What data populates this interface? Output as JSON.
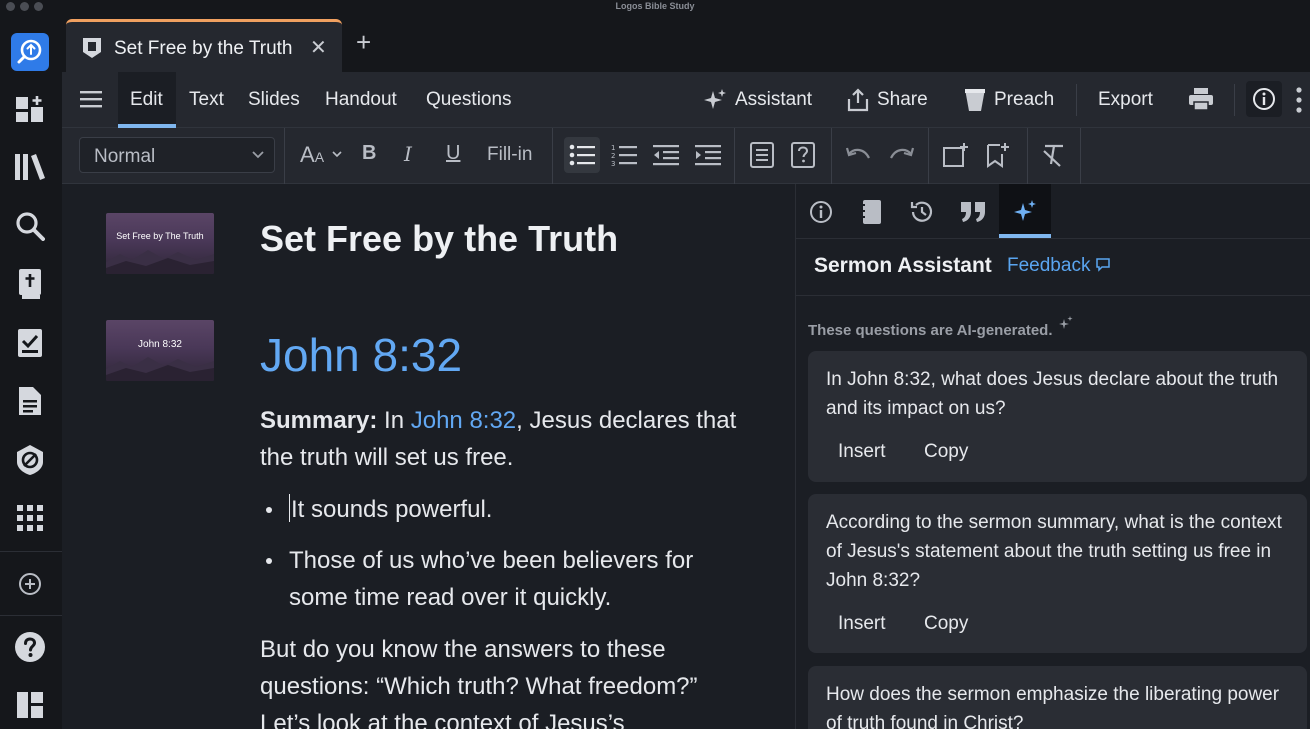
{
  "window": {
    "title": "Logos Bible Study"
  },
  "tab": {
    "title": "Set Free by the Truth",
    "close": "✕",
    "add": "+"
  },
  "menu": {
    "items": [
      "Edit",
      "Text",
      "Slides",
      "Handout",
      "Questions"
    ],
    "active": "Edit",
    "assistant": "Assistant",
    "share": "Share",
    "preach": "Preach",
    "export": "Export"
  },
  "format": {
    "style": "Normal",
    "font_size_icon": "A",
    "font_size_icon_small": "A",
    "bold": "B",
    "italic": "I",
    "underline": "U",
    "fill_in": "Fill-in"
  },
  "editor": {
    "title": "Set Free by the Truth",
    "slide1_text": "Set Free by The Truth",
    "slide2_text": "John 8:32",
    "reference": "John 8:32",
    "summary_label": "Summary:",
    "summary_pre": " In ",
    "summary_link": "John 8:32",
    "summary_post": ", Jesus declares that the truth will set us free.",
    "bullet1": "It sounds powerful.",
    "bullet2": "Those of us who’ve been believers for some time read over it quickly.",
    "para2": "But do you know the answers to these questions: “Which truth? What freedom?” Let’s look at the context of Jesus’s"
  },
  "panel": {
    "title": "Sermon Assistant",
    "feedback": "Feedback",
    "ai_note": "These questions are AI-generated.",
    "cards": [
      {
        "question": "In John 8:32, what does Jesus declare about the truth and its impact on us?",
        "insert": "Insert",
        "copy": "Copy"
      },
      {
        "question": "According to the sermon summary, what is the context of Jesus's statement about the truth setting us free in John 8:32?",
        "insert": "Insert",
        "copy": "Copy"
      },
      {
        "question": "How does the sermon emphasize the liberating power of truth found in Christ?"
      }
    ]
  },
  "colors": {
    "accent": "#62a8f3",
    "tab_accent": "#f0a060",
    "active_underline": "#7fb6ee"
  }
}
